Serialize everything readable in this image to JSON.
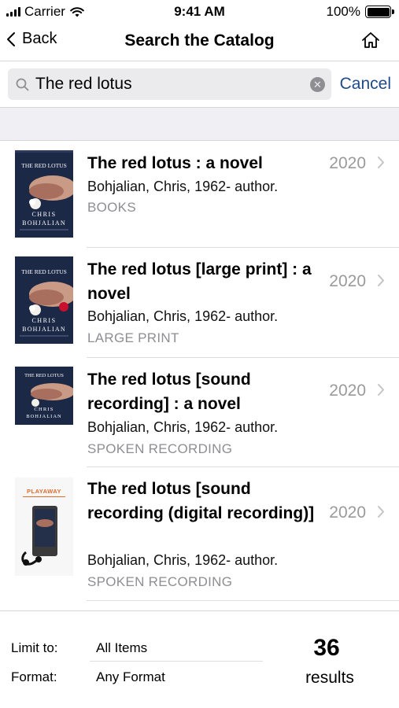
{
  "status_bar": {
    "carrier": "Carrier",
    "time": "9:41 AM",
    "battery": "100%"
  },
  "nav": {
    "back_label": "Back",
    "title": "Search the Catalog",
    "home_icon": "home-icon"
  },
  "search": {
    "value": "The red lotus",
    "cancel_label": "Cancel"
  },
  "results": [
    {
      "title": "The red lotus : a novel",
      "author": "Bohjalian, Chris, 1962- author.",
      "format": "BOOKS",
      "year": "2020",
      "cover_text": [
        "THE RED LOTUS",
        "CHRIS",
        "BOHJALIAN"
      ]
    },
    {
      "title": "The red lotus [large print] : a novel",
      "author": "Bohjalian, Chris, 1962- author.",
      "format": "LARGE PRINT",
      "year": "2020",
      "cover_text": [
        "THE RED LOTUS",
        "CHRIS",
        "BOHJALIAN"
      ]
    },
    {
      "title": "The red lotus [sound recording] : a novel",
      "author": "Bohjalian, Chris, 1962- author.",
      "format": "SPOKEN RECORDING",
      "year": "2020",
      "cover_text": [
        "THE RED LOTUS",
        "CHRIS",
        "BOHJALIAN"
      ]
    },
    {
      "title": "The red lotus [sound recording (digital recording)]",
      "author": "Bohjalian, Chris, 1962- author.",
      "format": "SPOKEN RECORDING",
      "year": "2020",
      "cover_text": [
        "PLAYAWAY"
      ]
    }
  ],
  "filters": {
    "limit_label": "Limit to:",
    "limit_value": "All Items",
    "format_label": "Format:",
    "format_value": "Any Format"
  },
  "summary": {
    "count": "36",
    "label": "results"
  },
  "colors": {
    "accent": "#1f4a8a",
    "muted": "#8e8e93",
    "band": "#efeff4"
  }
}
